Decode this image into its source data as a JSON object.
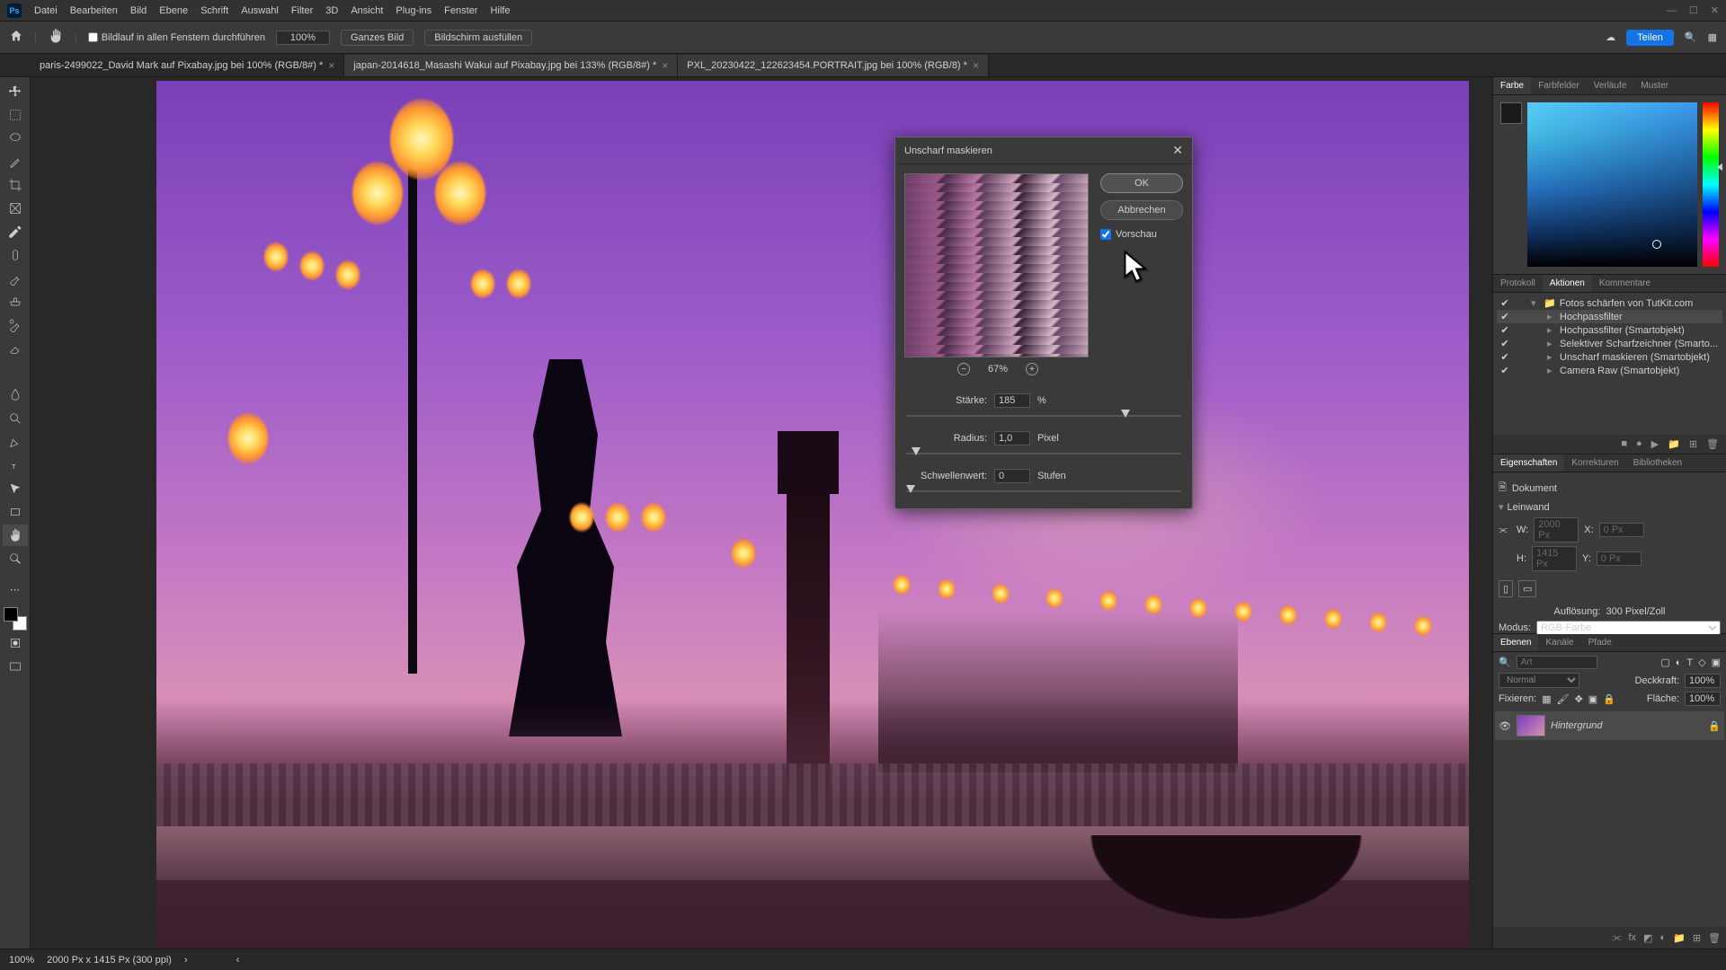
{
  "menu": {
    "items": [
      "Datei",
      "Bearbeiten",
      "Bild",
      "Ebene",
      "Schrift",
      "Auswahl",
      "Filter",
      "3D",
      "Ansicht",
      "Plug-ins",
      "Fenster",
      "Hilfe"
    ],
    "app_initials": "Ps"
  },
  "options": {
    "scroll_all": "Bildlauf in allen Fenstern durchführen",
    "zoom": "100%",
    "fit_whole": "Ganzes Bild",
    "fill_screen": "Bildschirm ausfüllen",
    "share": "Teilen"
  },
  "tabs": [
    {
      "label": "paris-2499022_David Mark auf Pixabay.jpg bei 100% (RGB/8#) *",
      "active": true
    },
    {
      "label": "japan-2014618_Masashi Wakui auf Pixabay.jpg bei 133% (RGB/8#) *",
      "active": false
    },
    {
      "label": "PXL_20230422_122623454.PORTRAIT.jpg bei 100% (RGB/8) *",
      "active": false
    }
  ],
  "statusbar": {
    "zoom": "100%",
    "dims": "2000 Px x 1415 Px (300 ppi)"
  },
  "panel_tabs": {
    "color": [
      "Farbe",
      "Farbfelder",
      "Verläufe",
      "Muster"
    ],
    "actions": [
      "Protokoll",
      "Aktionen",
      "Kommentare"
    ],
    "props": [
      "Eigenschaften",
      "Korrekturen",
      "Bibliotheken"
    ],
    "layers": [
      "Ebenen",
      "Kanäle",
      "Pfade"
    ]
  },
  "actions": {
    "set": "Fotos schärfen von TutKit.com",
    "items": [
      "Hochpassfilter",
      "Hochpassfilter (Smartobjekt)",
      "Selektiver Scharfzeichner (Smarto...",
      "Unscharf maskieren (Smartobjekt)",
      "Camera Raw (Smartobjekt)"
    ],
    "selected_index": 0
  },
  "properties": {
    "doc": "Dokument",
    "canvas": "Leinwand",
    "w": "W:",
    "h": "H:",
    "x": "X:",
    "y": "Y:",
    "w_val": "2000 Px",
    "h_val": "1415 Px",
    "x_val": "0 Px",
    "y_val": "0 Px",
    "resolution_label": "Auflösung:",
    "resolution": "300 Pixel/Zoll",
    "mode_label": "Modus:",
    "mode": "RGB-Farbe"
  },
  "layers": {
    "search_placeholder": "Art",
    "blend": "Normal",
    "opacity_label": "Deckkraft:",
    "opacity": "100%",
    "lock_label": "Fixieren:",
    "fill_label": "Fläche:",
    "fill": "100%",
    "layer_name": "Hintergrund"
  },
  "dialog": {
    "title": "Unscharf maskieren",
    "ok": "OK",
    "cancel": "Abbrechen",
    "preview": "Vorschau",
    "zoom": "67%",
    "amount_label": "Stärke:",
    "amount_value": "185",
    "amount_unit": "%",
    "radius_label": "Radius:",
    "radius_value": "1,0",
    "radius_unit": "Pixel",
    "threshold_label": "Schwellenwert:",
    "threshold_value": "0",
    "threshold_unit": "Stufen"
  },
  "chart_data": {
    "type": "table",
    "title": "Unscharf maskieren — Parameter",
    "rows": [
      {
        "param": "Stärke",
        "value": 185,
        "unit": "%"
      },
      {
        "param": "Radius",
        "value": 1.0,
        "unit": "Pixel"
      },
      {
        "param": "Schwellenwert",
        "value": 0,
        "unit": "Stufen"
      }
    ]
  }
}
